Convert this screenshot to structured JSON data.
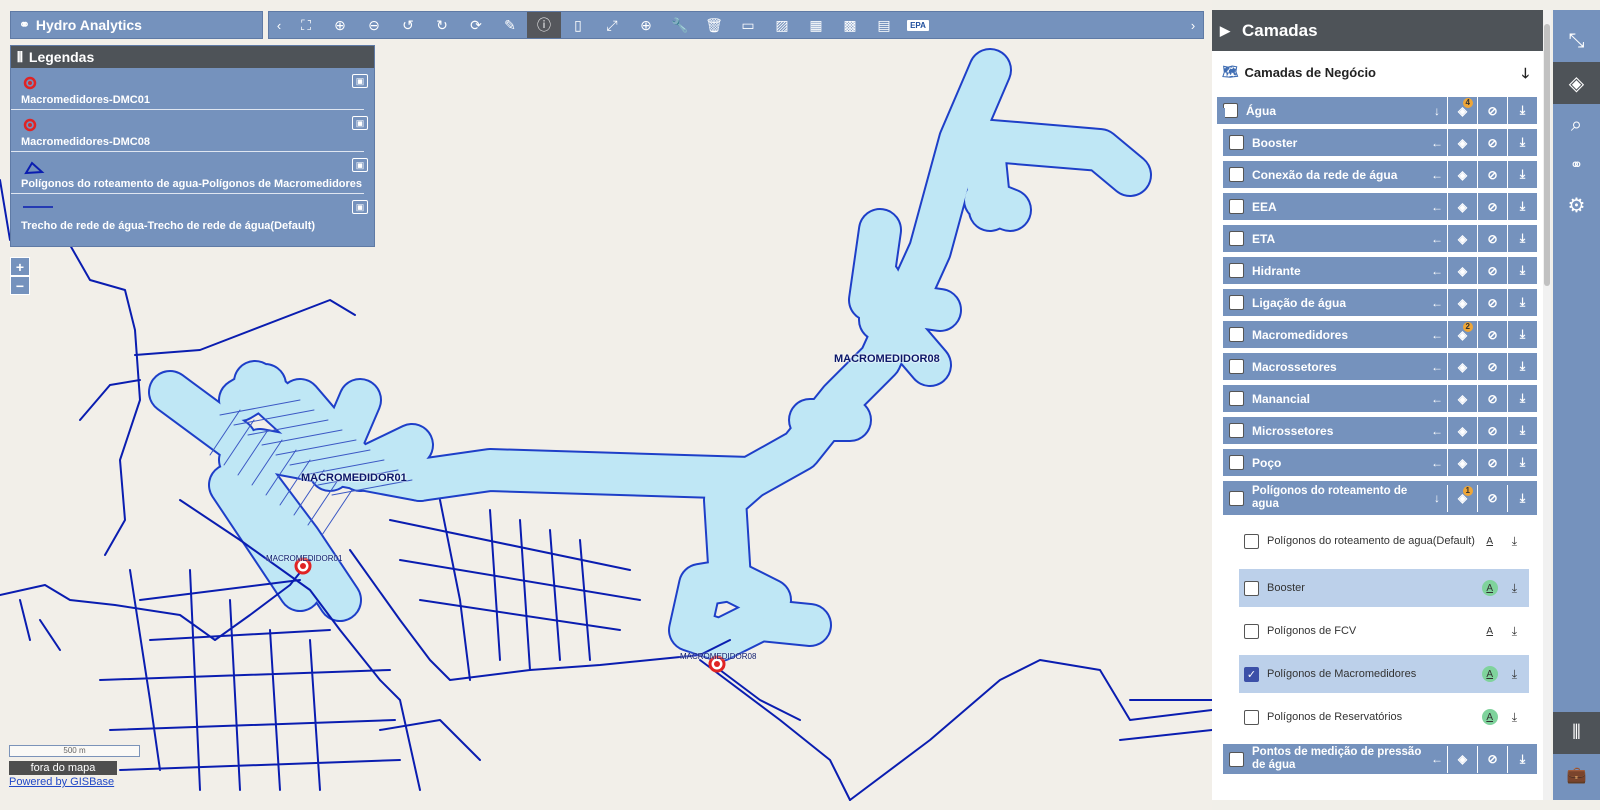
{
  "app": {
    "title": "Hydro Analytics"
  },
  "toolbar": {
    "prev": "‹",
    "next": "›",
    "tools": [
      {
        "name": "zoom-extent-icon",
        "glyph": "⛶"
      },
      {
        "name": "zoom-in-icon",
        "glyph": "⊕"
      },
      {
        "name": "zoom-out-icon",
        "glyph": "⊖"
      },
      {
        "name": "history-back-icon",
        "glyph": "↺"
      },
      {
        "name": "history-forward-icon",
        "glyph": "↻"
      },
      {
        "name": "refresh-icon",
        "glyph": "⟳"
      },
      {
        "name": "eraser-icon",
        "glyph": "✎"
      },
      {
        "name": "info-icon",
        "glyph": "ⓘ",
        "active": true
      },
      {
        "name": "phone-icon",
        "glyph": "▯"
      },
      {
        "name": "fullscreen-icon",
        "glyph": "⤢"
      },
      {
        "name": "crosshair-icon",
        "glyph": "⊕"
      },
      {
        "name": "wrench-icon",
        "glyph": "🔧"
      },
      {
        "name": "trash-icon",
        "glyph": "🗑"
      },
      {
        "name": "ruler-icon",
        "glyph": "▭"
      },
      {
        "name": "hatch-icon",
        "glyph": "▨"
      },
      {
        "name": "grid-dots-icon",
        "glyph": "▦"
      },
      {
        "name": "grid-scatter-icon",
        "glyph": "▩"
      },
      {
        "name": "table-icon",
        "glyph": "▤"
      }
    ],
    "epa_label": "EPA"
  },
  "legend": {
    "title": "Legendas",
    "items": [
      {
        "label": "Macromedidores-DMC01",
        "symbol": "point"
      },
      {
        "label": "Macromedidores-DMC08",
        "symbol": "point"
      },
      {
        "label": "Polígonos do roteamento de agua-Polígonos de Macromedidores",
        "symbol": "polygon"
      },
      {
        "label": "Trecho de rede de água-Trecho de rede de água(Default)",
        "symbol": "line"
      }
    ]
  },
  "zoom": {
    "in": "+",
    "out": "−"
  },
  "scale": {
    "label": "500 m"
  },
  "status": {
    "text": "fora do mapa"
  },
  "powered": {
    "text": "Powered by GISBase"
  },
  "map_labels": {
    "macro01": "MACROMEDIDOR01",
    "macro08": "MACROMEDIDOR08",
    "pt01": "MACROMEDIDOR01",
    "pt08": "MACROMEDIDOR08"
  },
  "panel": {
    "title": "Camadas",
    "business": "Camadas de Negócio",
    "layers": [
      {
        "name": "Água",
        "badge": "4"
      },
      {
        "name": "Booster"
      },
      {
        "name": "Conexão da rede de água"
      },
      {
        "name": "EEA"
      },
      {
        "name": "ETA"
      },
      {
        "name": "Hidrante"
      },
      {
        "name": "Ligação de água"
      },
      {
        "name": "Macromedidores",
        "badge": "2"
      },
      {
        "name": "Macrossetores"
      },
      {
        "name": "Manancial"
      },
      {
        "name": "Microssetores"
      },
      {
        "name": "Poço"
      },
      {
        "name": "Polígonos do roteamento de agua",
        "badge": "1"
      }
    ],
    "sublayers": [
      {
        "name": "Polígonos do roteamento de agua(Default)",
        "checked": false,
        "highlight": false,
        "green": false
      },
      {
        "name": "Booster",
        "checked": false,
        "highlight": true,
        "green": true
      },
      {
        "name": "Polígonos de FCV",
        "checked": false,
        "highlight": false,
        "green": false
      },
      {
        "name": "Polígonos de Macromedidores",
        "checked": true,
        "highlight": true,
        "green": true
      },
      {
        "name": "Polígonos de Reservatórios",
        "checked": false,
        "highlight": false,
        "green": true
      }
    ],
    "bottom_layer": "Pontos de medição de pressão de água",
    "style_glyph": "A"
  },
  "colors": {
    "accent": "#7592bd",
    "dark": "#4e5358",
    "network": "#0a1db0",
    "polygon_fill": "#bfe7f5",
    "polygon_stroke": "#1e3fc8",
    "point": "#e02424"
  }
}
